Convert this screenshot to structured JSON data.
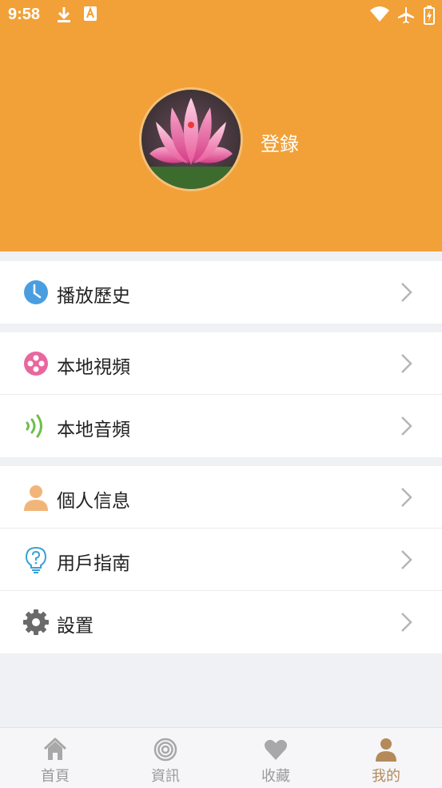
{
  "status_bar": {
    "time": "9:58",
    "left_icons": [
      "download-icon",
      "a-notification-icon"
    ],
    "right_icons": [
      "wifi-icon",
      "airplane-icon",
      "battery-charging-icon"
    ]
  },
  "header": {
    "background_color": "#f1a138",
    "login_label": "登錄"
  },
  "menu_groups": [
    {
      "items": [
        {
          "label": "播放歷史",
          "icon": "clock-icon"
        }
      ]
    },
    {
      "items": [
        {
          "label": "本地視頻",
          "icon": "film-reel-icon"
        },
        {
          "label": "本地音頻",
          "icon": "sound-wave-icon"
        }
      ]
    },
    {
      "items": [
        {
          "label": "個人信息",
          "icon": "person-icon"
        },
        {
          "label": "用戶指南",
          "icon": "lightbulb-question-icon"
        },
        {
          "label": "設置",
          "icon": "gear-icon"
        }
      ]
    }
  ],
  "tabbar": {
    "tabs": [
      {
        "label": "首頁",
        "icon": "home-icon"
      },
      {
        "label": "資訊",
        "icon": "target-icon"
      },
      {
        "label": "收藏",
        "icon": "heart-icon"
      },
      {
        "label": "我的",
        "icon": "person-icon"
      }
    ],
    "active_index": 3,
    "active_color": "#b58a5a",
    "inactive_color": "#9a9a9a"
  }
}
